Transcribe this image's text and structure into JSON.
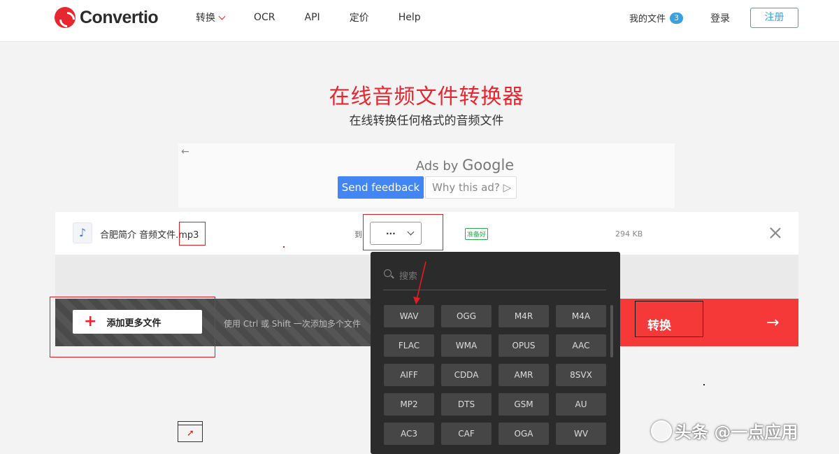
{
  "header": {
    "brand": "Convertio",
    "nav": [
      {
        "label": "转换",
        "has_dropdown": true
      },
      {
        "label": "OCR"
      },
      {
        "label": "API"
      },
      {
        "label": "定价"
      },
      {
        "label": "Help"
      }
    ],
    "my_files_label": "我的文件",
    "my_files_count": "3",
    "login_label": "登录",
    "register_label": "注册",
    "accent_color": "#e8262f",
    "link_color": "#3aa0e0"
  },
  "hero": {
    "title": "在线音频文件转换器",
    "subtitle": "在线转换任何格式的音频文件"
  },
  "ad": {
    "back_icon": "arrow-left-icon",
    "ads_by": "Ads by",
    "google": "Google",
    "send_feedback": "Send feedback",
    "why_ad": "Why this ad?"
  },
  "file": {
    "icon": "music-note-icon",
    "name_prefix": "合肥简介 音频文件.",
    "name_ext": "mp3",
    "to_label": "到",
    "format_value": "...",
    "status": "准备好",
    "size": "294 KB"
  },
  "actions": {
    "add_more": "添加更多文件",
    "hint": "使用 Ctrl 或 Shift 一次添加多个文件",
    "convert": "转换",
    "convert_color": "#f53838"
  },
  "dropdown": {
    "search_placeholder": "搜索",
    "formats": [
      "WAV",
      "OGG",
      "M4R",
      "M4A",
      "FLAC",
      "WMA",
      "OPUS",
      "AAC",
      "AIFF",
      "CDDA",
      "AMR",
      "8SVX",
      "MP2",
      "DTS",
      "GSM",
      "AU",
      "AC3",
      "CAF",
      "OGA",
      "WV"
    ]
  },
  "watermark": "头条 @一点应用"
}
